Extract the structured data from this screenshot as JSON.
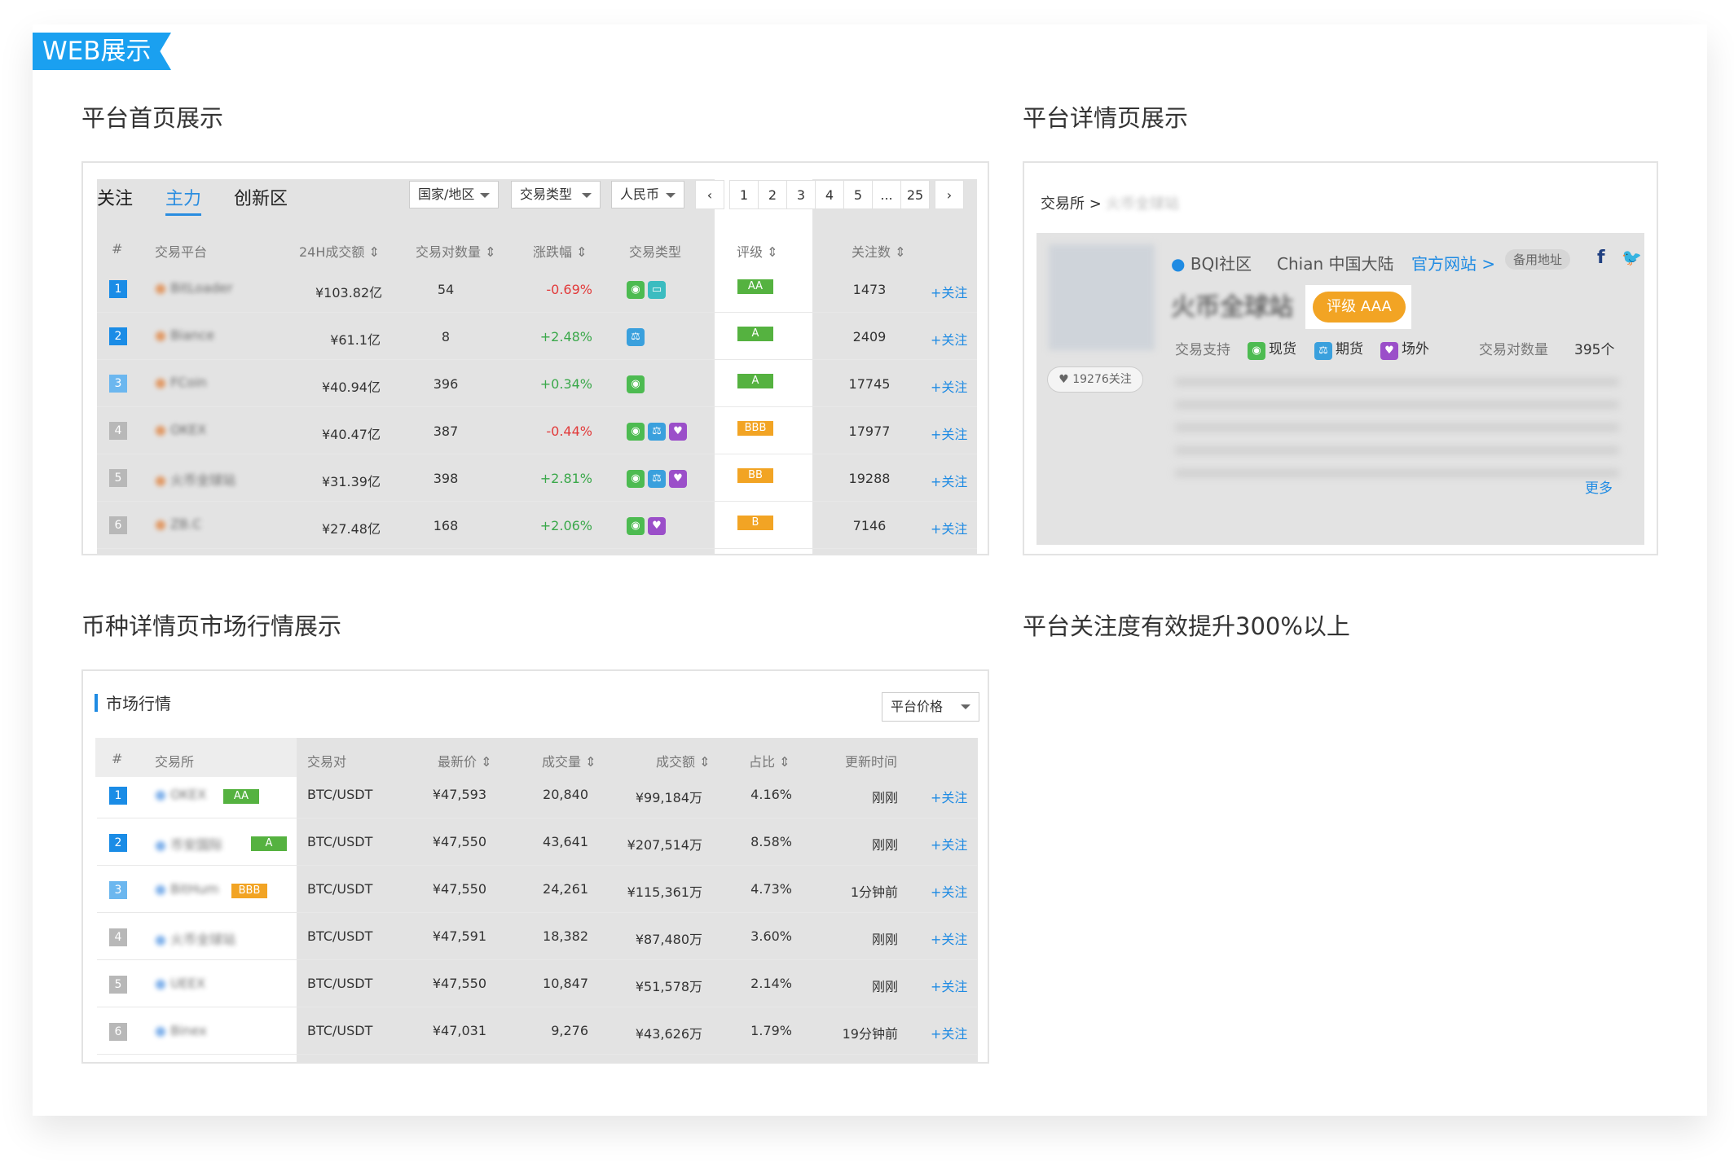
{
  "section_tag": "WEB展示",
  "headings": {
    "home": "平台首页展示",
    "detail": "平台详情页展示",
    "coin": "币种详情页市场行情展示",
    "note": "平台关注度有效提升300%以上"
  },
  "home": {
    "tabs": [
      "关注",
      "主力",
      "创新区"
    ],
    "filters": [
      "国家/地区",
      "交易类型",
      "人民币"
    ],
    "pages": [
      "‹",
      "1",
      "2",
      "3",
      "4",
      "5",
      "...",
      "25",
      "›"
    ],
    "headers": [
      "#",
      "交易平台",
      "24H成交额 ⇕",
      "交易对数量 ⇕",
      "涨跌幅 ⇕",
      "交易类型",
      "评级 ⇕",
      "关注数 ⇕"
    ],
    "rows": [
      {
        "rank": "1",
        "name": "BitLoader",
        "vol": "¥103.82亿",
        "pairs": "54",
        "chg": "-0.69%",
        "types": [
          "g",
          "t"
        ],
        "rate": "AA",
        "fans": "1473",
        "follow": "+关注"
      },
      {
        "rank": "2",
        "name": "Biance",
        "vol": "¥61.1亿",
        "pairs": "8",
        "chg": "+2.48%",
        "types": [
          "b"
        ],
        "rate": "A",
        "fans": "2409",
        "follow": "+关注"
      },
      {
        "rank": "3",
        "name": "FCoin",
        "vol": "¥40.94亿",
        "pairs": "396",
        "chg": "+0.34%",
        "types": [
          "g"
        ],
        "rate": "A",
        "fans": "17745",
        "follow": "+关注"
      },
      {
        "rank": "4",
        "name": "OKEX",
        "vol": "¥40.47亿",
        "pairs": "387",
        "chg": "-0.44%",
        "types": [
          "g",
          "b",
          "p"
        ],
        "rate": "BBB",
        "fans": "17977",
        "follow": "+关注"
      },
      {
        "rank": "5",
        "name": "火币全球站",
        "vol": "¥31.39亿",
        "pairs": "398",
        "chg": "+2.81%",
        "types": [
          "g",
          "b",
          "p"
        ],
        "rate": "BB",
        "fans": "19288",
        "follow": "+关注"
      },
      {
        "rank": "6",
        "name": "ZB.C",
        "vol": "¥27.48亿",
        "pairs": "168",
        "chg": "+2.06%",
        "types": [
          "g",
          "p"
        ],
        "rate": "B",
        "fans": "7146",
        "follow": "+关注"
      }
    ]
  },
  "detail": {
    "breadcrumb": "交易所 >",
    "breadcrumb_blur": "火币全球站",
    "community": "BQI社区",
    "region": "Chian 中国大陆",
    "site": "官方网站 >",
    "backup": "备用地址",
    "name": "火币全球站",
    "rating": "评级 AAA",
    "followers": "♥ 19276关注",
    "support_label": "交易支持",
    "support": [
      "现货",
      "期货",
      "场外"
    ],
    "pairs_label": "交易对数量",
    "pairs": "395个",
    "more": "更多"
  },
  "coin": {
    "title": "市场行情",
    "select": "平台价格",
    "headers": [
      "#",
      "交易所",
      "交易对",
      "最新价 ⇕",
      "成交量 ⇕",
      "成交额 ⇕",
      "占比 ⇕",
      "更新时间"
    ],
    "rows": [
      {
        "rank": "1",
        "name": "OKEX",
        "rate": "AA",
        "pair": "BTC/USDT",
        "price": "¥47,593",
        "amount": "20,840",
        "turnover": "¥99,184万",
        "share": "4.16%",
        "time": "刚刚",
        "follow": "+关注"
      },
      {
        "rank": "2",
        "name": "币安国际",
        "rate": "A",
        "pair": "BTC/USDT",
        "price": "¥47,550",
        "amount": "43,641",
        "turnover": "¥207,514万",
        "share": "8.58%",
        "time": "刚刚",
        "follow": "+关注"
      },
      {
        "rank": "3",
        "name": "BitHum",
        "rate": "BBB",
        "pair": "BTC/USDT",
        "price": "¥47,550",
        "amount": "24,261",
        "turnover": "¥115,361万",
        "share": "4.73%",
        "time": "1分钟前",
        "follow": "+关注"
      },
      {
        "rank": "4",
        "name": "火币全球站",
        "rate": "",
        "pair": "BTC/USDT",
        "price": "¥47,591",
        "amount": "18,382",
        "turnover": "¥87,480万",
        "share": "3.60%",
        "time": "刚刚",
        "follow": "+关注"
      },
      {
        "rank": "5",
        "name": "UEEX",
        "rate": "",
        "pair": "BTC/USDT",
        "price": "¥47,550",
        "amount": "10,847",
        "turnover": "¥51,578万",
        "share": "2.14%",
        "time": "刚刚",
        "follow": "+关注"
      },
      {
        "rank": "6",
        "name": "Binex",
        "rate": "",
        "pair": "BTC/USDT",
        "price": "¥47,031",
        "amount": "9,276",
        "turnover": "¥43,626万",
        "share": "1.79%",
        "time": "19分钟前",
        "follow": "+关注"
      }
    ]
  }
}
